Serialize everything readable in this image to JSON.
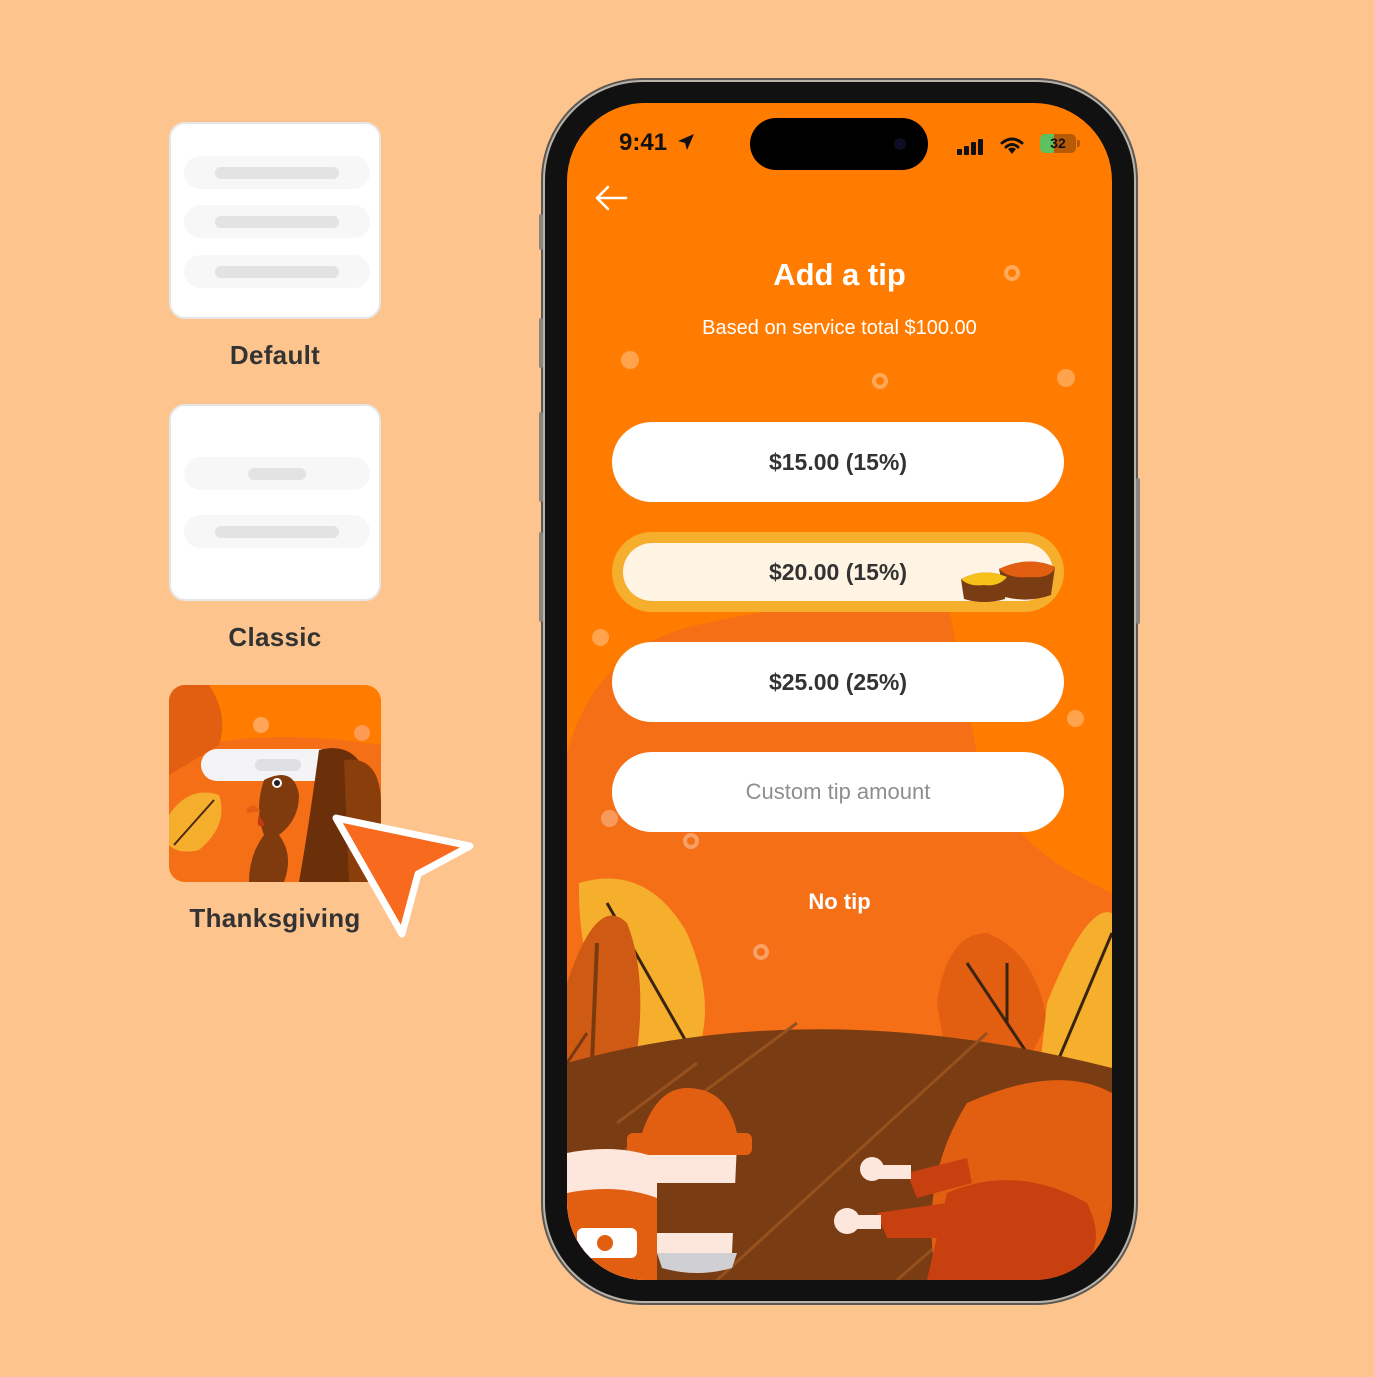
{
  "themes": [
    {
      "label": "Default",
      "selected": false
    },
    {
      "label": "Classic",
      "selected": false
    },
    {
      "label": "Thanksgiving",
      "selected": true
    }
  ],
  "status_bar": {
    "time": "9:41",
    "battery": "32",
    "battery_level_percent": 32
  },
  "screen": {
    "back_icon": "arrow-left-icon",
    "title": "Add a tip",
    "subtitle": "Based on service total $100.00",
    "tip_options": [
      {
        "label": "$15.00 (15%)",
        "selected": false
      },
      {
        "label": "$20.00 (15%)",
        "selected": true
      },
      {
        "label": "$25.00 (25%)",
        "selected": false
      }
    ],
    "custom_tip": {
      "placeholder": "Custom tip amount",
      "value": ""
    },
    "no_tip_label": "No tip"
  },
  "colors": {
    "background": "#FEC48E",
    "screen_orange": "#FF7C00",
    "selected_ring": "#F6AE2D",
    "selected_fill": "#FFF3E3",
    "text_dark": "#333333"
  }
}
